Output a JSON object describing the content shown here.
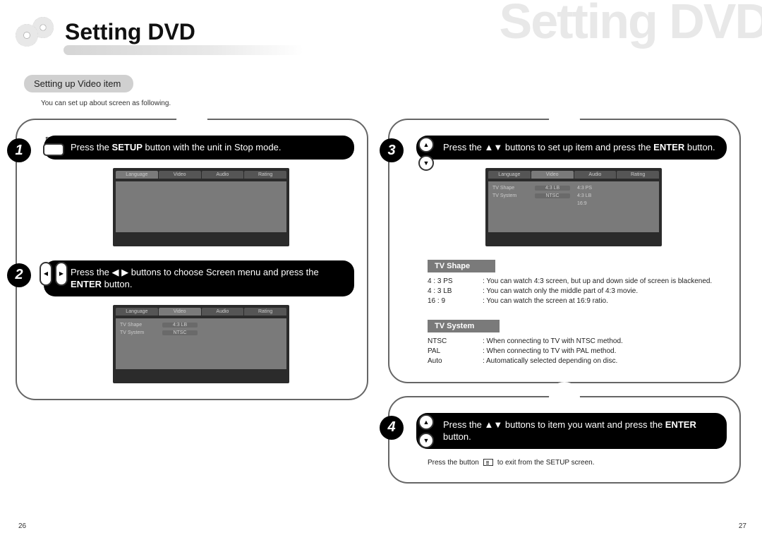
{
  "watermark": "Setting DVD",
  "title": "Setting DVD",
  "section_pill": "Setting up Video item",
  "section_note": "You can set up about screen as following.",
  "setup_label": "SETUP",
  "steps": {
    "s1": {
      "num": "1",
      "text_a": "Press the ",
      "text_b": "SETUP",
      "text_c": " button with the unit in Stop mode."
    },
    "s2": {
      "num": "2",
      "text_a": "Press the ◀ ▶ buttons to choose Screen menu and press the ",
      "text_b": "ENTER",
      "text_c": " button."
    },
    "s3": {
      "num": "3",
      "text_a": "Press the ▲▼ buttons to set up item and press the ",
      "text_b": "ENTER",
      "text_c": " button."
    },
    "s4": {
      "num": "4",
      "text_a": "Press the ▲▼ buttons to item you want and press the ",
      "text_b": "ENTER",
      "text_c": " button."
    }
  },
  "osd": {
    "tabs": [
      "Language",
      "Video",
      "Audio",
      "Rating"
    ],
    "rows_video": [
      {
        "label": "TV Shape",
        "value": "4:3 LB"
      },
      {
        "label": "TV System",
        "value": "NTSC"
      }
    ],
    "rows_video_options": [
      {
        "label": "TV Shape",
        "value": "4:3 LB",
        "opts": [
          "4:3 PS",
          "4:3 LB",
          "16:9"
        ]
      },
      {
        "label": "TV System",
        "value": "NTSC"
      }
    ]
  },
  "tv_shape": {
    "head": "TV Shape",
    "items": [
      {
        "k": "4 : 3 PS",
        "v": ": You can watch 4:3 screen, but up and down side of screen is blackened."
      },
      {
        "k": "4 : 3 LB",
        "v": ": You can watch only the middle part of 4:3 movie."
      },
      {
        "k": "16 : 9",
        "v": ": You can watch the screen at 16:9 ratio."
      }
    ]
  },
  "tv_system": {
    "head": "TV System",
    "items": [
      {
        "k": "NTSC",
        "v": ": When connecting to TV with NTSC method."
      },
      {
        "k": "PAL",
        "v": ": When connecting to TV with PAL method."
      },
      {
        "k": "Auto",
        "v": ": Automatically selected depending on disc."
      }
    ]
  },
  "exit_note_a": "Press the button",
  "exit_note_b": "to exit from the SETUP screen.",
  "page_left": "26",
  "page_right": "27"
}
